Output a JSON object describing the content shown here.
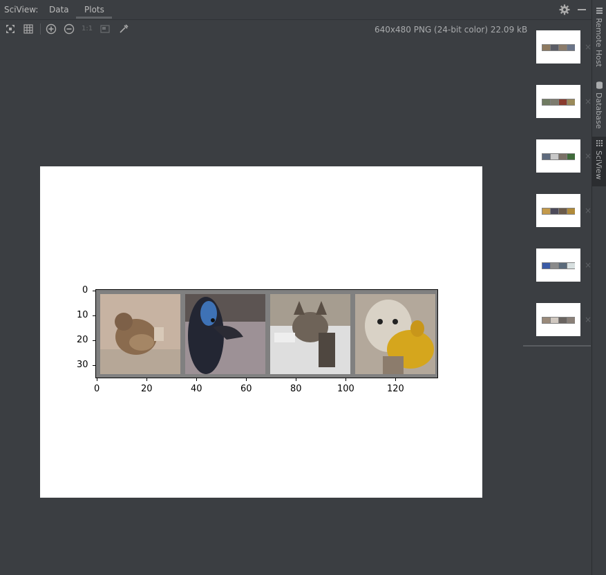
{
  "header": {
    "app_title": "SciView:",
    "tabs": [
      {
        "label": "Data"
      },
      {
        "label": "Plots"
      }
    ],
    "active_tab": "Plots"
  },
  "toolbar": {
    "actual_size_label": "1:1",
    "image_info": "640x480 PNG (24-bit color) 22.09 kB"
  },
  "plot": {
    "y_ticks": [
      "0",
      "10",
      "20",
      "30"
    ],
    "x_ticks": [
      "0",
      "20",
      "40",
      "60",
      "80",
      "100",
      "120"
    ],
    "tiles": [
      {
        "subject": "bird",
        "colors": [
          "#b9a593",
          "#8a6b4e"
        ]
      },
      {
        "subject": "emu",
        "colors": [
          "#9b8f93",
          "#2a2d3e"
        ]
      },
      {
        "subject": "cat",
        "colors": [
          "#d8d8d8",
          "#6f665e"
        ]
      },
      {
        "subject": "dog",
        "colors": [
          "#c4bdb1",
          "#d2a320"
        ]
      }
    ]
  },
  "thumbnails": {
    "count": 6,
    "close_symbol": "×"
  },
  "sidebar": {
    "tabs": [
      {
        "label": "Remote Host"
      },
      {
        "label": "Database"
      },
      {
        "label": "SciView"
      }
    ],
    "active": "SciView"
  },
  "colors": {
    "background": "#3b3e42",
    "text": "#bbbbbb",
    "plot_background": "#ffffff"
  }
}
